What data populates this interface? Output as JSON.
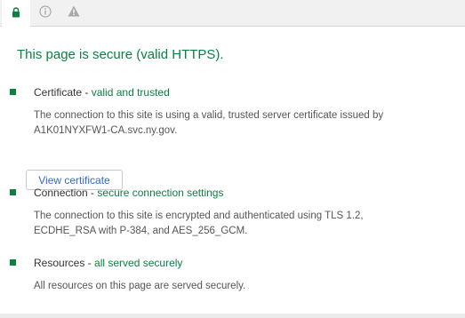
{
  "tabs": [
    {
      "icon": "lock-icon",
      "color": "#0b8043",
      "active": true
    },
    {
      "icon": "info-circle-icon",
      "color": "#a8a8a8",
      "active": false
    },
    {
      "icon": "warning-triangle-icon",
      "color": "#a8a8a8",
      "active": false
    }
  ],
  "headline": "This page is secure (valid HTTPS).",
  "certificate": {
    "title": "Certificate",
    "separator": " - ",
    "status": "valid and trusted",
    "description": "The connection to this site is using a valid, trusted server certificate issued by A1K01NYXFW1-CA.svc.ny.gov.",
    "button_label": "View certificate"
  },
  "connection": {
    "title": "Connection",
    "separator": " - ",
    "status": "secure connection settings",
    "description": "The connection to this site is encrypted and authenticated using TLS 1.2, ECDHE_RSA with P-384, and AES_256_GCM."
  },
  "resources": {
    "title": "Resources",
    "separator": " - ",
    "status": "all served securely",
    "description": "All resources on this page are served securely."
  },
  "colors": {
    "secure_green": "#0b8043",
    "link_blue": "#3367d6",
    "inactive_icon": "#a8a8a8"
  }
}
